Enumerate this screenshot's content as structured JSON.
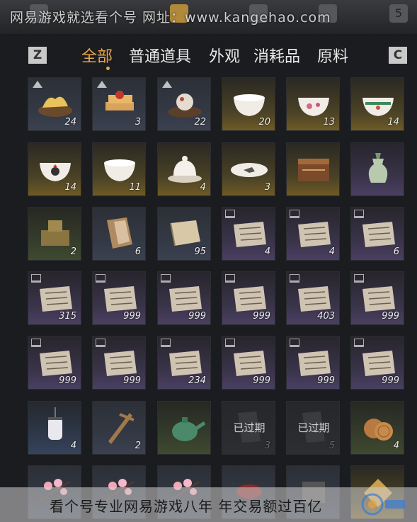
{
  "watermarks": {
    "top": "网易游戏就选看个号  网址：www.kangehao.com",
    "bottom": "看个号专业网易游戏八年 年交易额过百亿"
  },
  "top_icons": [
    "top-slot-1",
    "top-slot-2",
    "top-slot-3",
    "top-slot-4",
    "top-slot-5"
  ],
  "top_key_label": "5",
  "tabs": {
    "left_key": "Z",
    "right_key": "C",
    "items": [
      {
        "label": "全部",
        "active": true
      },
      {
        "label": "普通道具",
        "active": false
      },
      {
        "label": "外观",
        "active": false
      },
      {
        "label": "消耗品",
        "active": false
      },
      {
        "label": "原料",
        "active": false
      }
    ]
  },
  "items": [
    {
      "name": "fried-food",
      "qty": "24",
      "rarity": "gray",
      "mark": "triangle"
    },
    {
      "name": "sliced-cake",
      "qty": "3",
      "rarity": "gray",
      "mark": "triangle"
    },
    {
      "name": "meat-dish",
      "qty": "22",
      "rarity": "gray",
      "mark": "triangle"
    },
    {
      "name": "white-bowl",
      "qty": "20",
      "rarity": "gold",
      "mark": ""
    },
    {
      "name": "flower-bowl",
      "qty": "13",
      "rarity": "gold",
      "mark": ""
    },
    {
      "name": "painted-bowl",
      "qty": "14",
      "rarity": "gold",
      "mark": ""
    },
    {
      "name": "rooster-bowl",
      "qty": "14",
      "rarity": "gold",
      "mark": ""
    },
    {
      "name": "floral-bowl",
      "qty": "11",
      "rarity": "gold",
      "mark": ""
    },
    {
      "name": "lidded-bowl",
      "qty": "4",
      "rarity": "gold",
      "mark": ""
    },
    {
      "name": "fish-dish",
      "qty": "3",
      "rarity": "gold",
      "mark": ""
    },
    {
      "name": "carved-box",
      "qty": "",
      "rarity": "gold",
      "mark": ""
    },
    {
      "name": "jade-vase",
      "qty": "",
      "rarity": "purple",
      "mark": ""
    },
    {
      "name": "bronze-seal",
      "qty": "2",
      "rarity": "green",
      "mark": ""
    },
    {
      "name": "folded-book",
      "qty": "6",
      "rarity": "gray",
      "mark": ""
    },
    {
      "name": "paper-scroll",
      "qty": "95",
      "rarity": "gray",
      "mark": ""
    },
    {
      "name": "document",
      "qty": "4",
      "rarity": "purple",
      "mark": "badge"
    },
    {
      "name": "document",
      "qty": "4",
      "rarity": "purple",
      "mark": "badge"
    },
    {
      "name": "document",
      "qty": "6",
      "rarity": "purple",
      "mark": "badge"
    },
    {
      "name": "document",
      "qty": "315",
      "rarity": "purple",
      "mark": "badge"
    },
    {
      "name": "document",
      "qty": "999",
      "rarity": "purple",
      "mark": "badge"
    },
    {
      "name": "document",
      "qty": "999",
      "rarity": "purple",
      "mark": "badge"
    },
    {
      "name": "document",
      "qty": "999",
      "rarity": "purple",
      "mark": "badge"
    },
    {
      "name": "document",
      "qty": "403",
      "rarity": "purple",
      "mark": "badge"
    },
    {
      "name": "document",
      "qty": "999",
      "rarity": "purple",
      "mark": "badge"
    },
    {
      "name": "document",
      "qty": "999",
      "rarity": "purple",
      "mark": "badge"
    },
    {
      "name": "document",
      "qty": "999",
      "rarity": "purple",
      "mark": "badge"
    },
    {
      "name": "document",
      "qty": "234",
      "rarity": "purple",
      "mark": "badge"
    },
    {
      "name": "document",
      "qty": "999",
      "rarity": "purple",
      "mark": "badge"
    },
    {
      "name": "document",
      "qty": "999",
      "rarity": "purple",
      "mark": "badge"
    },
    {
      "name": "document",
      "qty": "999",
      "rarity": "purple",
      "mark": "badge"
    },
    {
      "name": "lantern",
      "qty": "4",
      "rarity": "blue",
      "mark": ""
    },
    {
      "name": "wooden-tool",
      "qty": "2",
      "rarity": "gray",
      "mark": ""
    },
    {
      "name": "green-teapot",
      "qty": "",
      "rarity": "green",
      "mark": ""
    },
    {
      "name": "expired-item",
      "qty": "3",
      "rarity": "dark",
      "mark": "",
      "expired": "已过期"
    },
    {
      "name": "expired-item",
      "qty": "5",
      "rarity": "dark",
      "mark": "",
      "expired": "已过期"
    },
    {
      "name": "pastry",
      "qty": "4",
      "rarity": "green",
      "mark": ""
    },
    {
      "name": "peach-blossom",
      "qty": "",
      "rarity": "gray",
      "mark": ""
    },
    {
      "name": "peach-blossom",
      "qty": "",
      "rarity": "gray",
      "mark": ""
    },
    {
      "name": "peach-blossom",
      "qty": "",
      "rarity": "gray",
      "mark": ""
    },
    {
      "name": "red-item",
      "qty": "",
      "rarity": "gray",
      "mark": ""
    },
    {
      "name": "unknown-item",
      "qty": "",
      "rarity": "gray",
      "mark": ""
    },
    {
      "name": "gold-item",
      "qty": "",
      "rarity": "gold",
      "mark": ""
    }
  ]
}
